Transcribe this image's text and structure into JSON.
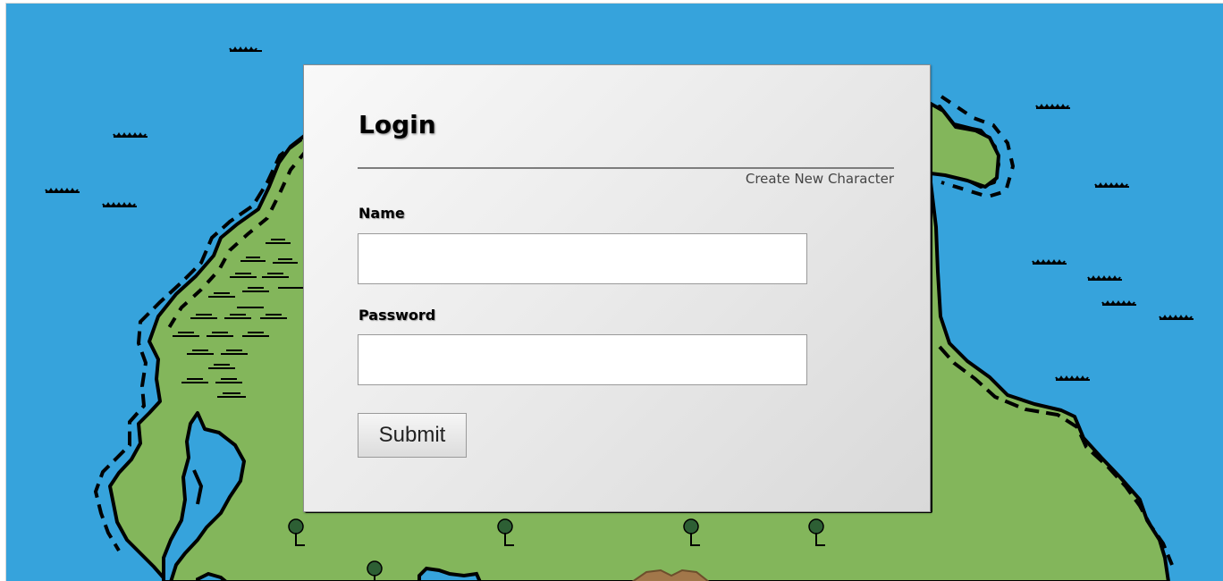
{
  "login": {
    "title": "Login",
    "create_link": "Create New Character",
    "name_label": "Name",
    "name_value": "",
    "password_label": "Password",
    "password_value": "",
    "submit_label": "Submit"
  },
  "colors": {
    "ocean": "#36a3dc",
    "land": "#83b65b",
    "outline": "#000000",
    "panel": "#e6e6e6",
    "tree": "#2d5f34",
    "mountain": "#a2774a"
  }
}
